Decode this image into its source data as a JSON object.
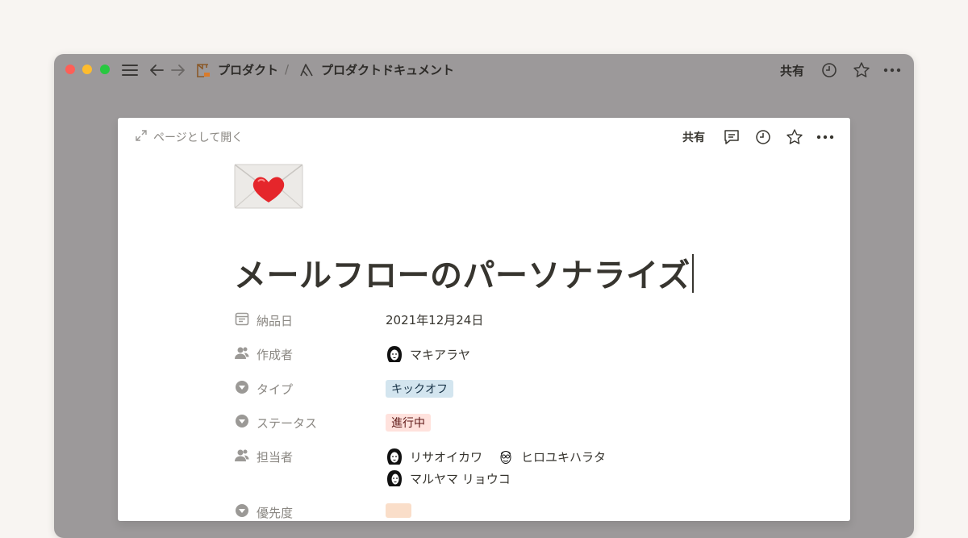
{
  "window": {
    "breadcrumb": [
      {
        "label": "プロダクト",
        "icon": "crane-icon"
      },
      {
        "label": "プロダクトドキュメント",
        "icon": "product-logo-icon"
      }
    ],
    "breadcrumb_separator": "/",
    "share_label": "共有"
  },
  "modal": {
    "open_as_page_label": "ページとして開く",
    "share_label": "共有"
  },
  "page": {
    "icon": "love-letter-icon",
    "title": "メールフローのパーソナライズ",
    "properties": {
      "due_date": {
        "label": "納品日",
        "value": "2021年12月24日"
      },
      "created_by": {
        "label": "作成者",
        "person": "マキアラヤ"
      },
      "type": {
        "label": "タイプ",
        "tag": "キックオフ",
        "tag_color": "#d3e5ef"
      },
      "status": {
        "label": "ステータス",
        "tag": "進行中",
        "tag_color": "#ffe2dd"
      },
      "assignees": {
        "label": "担当者",
        "people": [
          "リサオイカワ",
          "ヒロユキハラタ",
          "マルヤマ リョウコ"
        ]
      },
      "priority": {
        "label": "優先度",
        "tag_color": "#fadec9"
      }
    }
  }
}
